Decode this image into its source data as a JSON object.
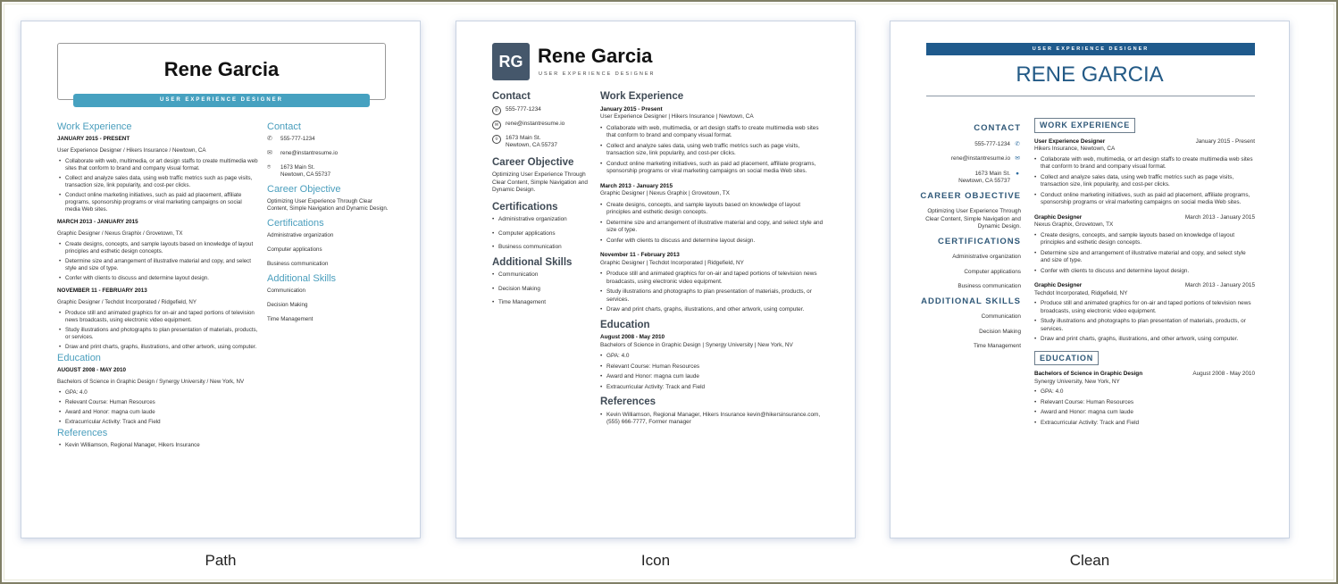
{
  "captions": [
    "Path",
    "Icon",
    "Clean"
  ],
  "colors": {
    "path_accent": "#46a1c0",
    "icon_badge": "#45576b",
    "clean_accent": "#1f5a8c"
  },
  "resume": {
    "name": "Rene Garcia",
    "name_upper": "RENE GARCIA",
    "initials": "RG",
    "title": "USER EXPERIENCE DESIGNER",
    "contact": {
      "heading": "Contact",
      "heading_upper": "CONTACT",
      "phone": "555-777-1234",
      "email": "rene@instantresume.io",
      "address_line1": "1673 Main St.",
      "address_line2": "Newtown, CA 55737",
      "icons": [
        "phone-icon",
        "email-icon",
        "location-icon"
      ]
    },
    "objective": {
      "heading": "Career Objective",
      "heading_upper": "CAREER OBJECTIVE",
      "text": "Optimizing User Experience Through Clear Content, Simple Navigation and Dynamic Design."
    },
    "certifications": {
      "heading": "Certifications",
      "heading_upper": "CERTIFICATIONS",
      "items": [
        "Administrative organization",
        "Computer applications",
        "Business communication"
      ]
    },
    "skills": {
      "heading": "Additional Skills",
      "heading_upper": "ADDITIONAL SKILLS",
      "items": [
        "Communication",
        "Decision Making",
        "Time Management"
      ]
    },
    "work": {
      "heading": "Work Experience",
      "heading_upper": "WORK EXPERIENCE",
      "jobs": [
        {
          "date": "January 2015 - Present",
          "date_upper": "JANUARY 2015 - PRESENT",
          "role": "User Experience Designer",
          "company": "Hikers Insurance",
          "location": "Newtown, CA",
          "path_line": "User Experience Designer  /  Hikers Insurance  /  Newtown, CA",
          "icon_line": "User Experience Designer | Hikers Insurance | Newtown, CA",
          "clean_org": "Hikers Insurance, Newtown, CA",
          "bullets": [
            "Collaborate with web, multimedia, or art design staffs to create multimedia web sites that conform to brand and company visual format.",
            "Collect and analyze sales data, using web traffic metrics such as page visits, transaction size, link popularity, and cost-per clicks.",
            "Conduct online marketing initiatives, such as paid ad placement, affiliate programs, sponsorship programs or viral marketing campaigns on social media Web sites."
          ]
        },
        {
          "date": "March 2013 - January 2015",
          "date_upper": "MARCH 2013 - JANUARY 2015",
          "role": "Graphic Designer",
          "company": "Nexus Graphix",
          "location": "Grovetown, TX",
          "path_line": "Graphic Designer  /  Nexus Graphix  /  Grovetown, TX",
          "icon_line": "Graphic Designer | Nexus Graphix | Grovetown, TX",
          "clean_org": "Nexus Graphix, Grovetown, TX",
          "bullets": [
            "Create designs, concepts, and sample layouts based on knowledge of layout principles and esthetic design concepts.",
            "Determine size and arrangement of illustrative material and copy, and select style and size of type.",
            "Confer with clients to discuss and determine layout design."
          ]
        },
        {
          "date": "November 11 - February 2013",
          "date_upper": "NOVEMBER 11 - FEBRUARY 2013",
          "clean_date": "March 2013 - January 2015",
          "role": "Graphic Designer",
          "company": "Techdot Incorporated",
          "location": "Ridgefield, NY",
          "path_line": "Graphic Designer  /  Techdot Incorporated  /  Ridgefield, NY",
          "icon_line": "Graphic Designer | Techdot Incorporated | Ridgefield, NY",
          "clean_org": "Techdot Incorporated, Ridgefield, NY",
          "bullets": [
            "Produce still and animated graphics for on-air and taped portions of television news broadcasts, using electronic video equipment.",
            "Study illustrations and photographs to plan presentation of materials, products, or services.",
            "Draw and print charts, graphs, illustrations, and other artwork, using computer."
          ]
        }
      ]
    },
    "education": {
      "heading": "Education",
      "heading_upper": "EDUCATION",
      "date": "August 2008 - May 2010",
      "date_upper": "AUGUST 2008 - MAY 2010",
      "degree": "Bachelors of Science in Graphic Design",
      "path_line": "Bachelors of Science in Graphic Design  /  Synergy University  /  New York, NV",
      "icon_line": "Bachelors of Science in Graphic Design | Synergy University | New York, NV",
      "clean_org": "Synergy University, New York, NY",
      "bullets": [
        "GPA: 4.0",
        "Relevant Course: Human Resources",
        "Award and Honor: magna cum laude",
        "Extracurricular Activity: Track and Field"
      ]
    },
    "references": {
      "heading": "References",
      "path_item": "Kevin Williamson, Regional Manager, Hikers Insurance",
      "icon_item": "Kevin Williamson, Regional Manager, Hikers Insurance kevin@hikersinsurance.com, (555) 666-7777, Former manager"
    }
  }
}
